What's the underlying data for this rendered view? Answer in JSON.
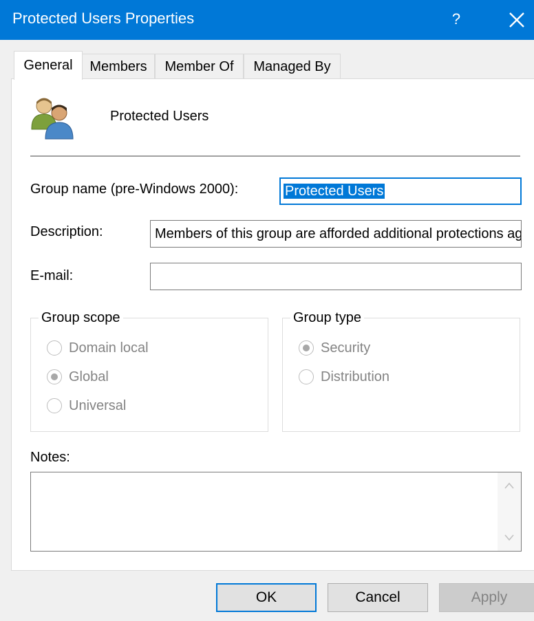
{
  "window": {
    "title": "Protected Users Properties",
    "help": "?"
  },
  "tabs": [
    {
      "label": "General",
      "active": true
    },
    {
      "label": "Members"
    },
    {
      "label": "Member Of"
    },
    {
      "label": "Managed By"
    }
  ],
  "header": {
    "group_name": "Protected Users",
    "icon": "users-group-icon"
  },
  "fields": {
    "prewin_label": "Group name (pre-Windows 2000):",
    "prewin_value": "Protected Users",
    "description_label": "Description:",
    "description_value": "Members of this group are afforded additional protections against authentication security threats",
    "email_label": "E-mail:",
    "email_value": ""
  },
  "group_scope": {
    "legend": "Group scope",
    "options": [
      {
        "label": "Domain local",
        "checked": false
      },
      {
        "label": "Global",
        "checked": true
      },
      {
        "label": "Universal",
        "checked": false
      }
    ]
  },
  "group_type": {
    "legend": "Group type",
    "options": [
      {
        "label": "Security",
        "checked": true
      },
      {
        "label": "Distribution",
        "checked": false
      }
    ]
  },
  "notes": {
    "label": "Notes:",
    "value": ""
  },
  "buttons": {
    "ok": "OK",
    "cancel": "Cancel",
    "apply": "Apply"
  },
  "colors": {
    "accent": "#0078d7",
    "panel": "#ffffff",
    "dialog": "#f0f0f0",
    "disabled_text": "#838383"
  }
}
